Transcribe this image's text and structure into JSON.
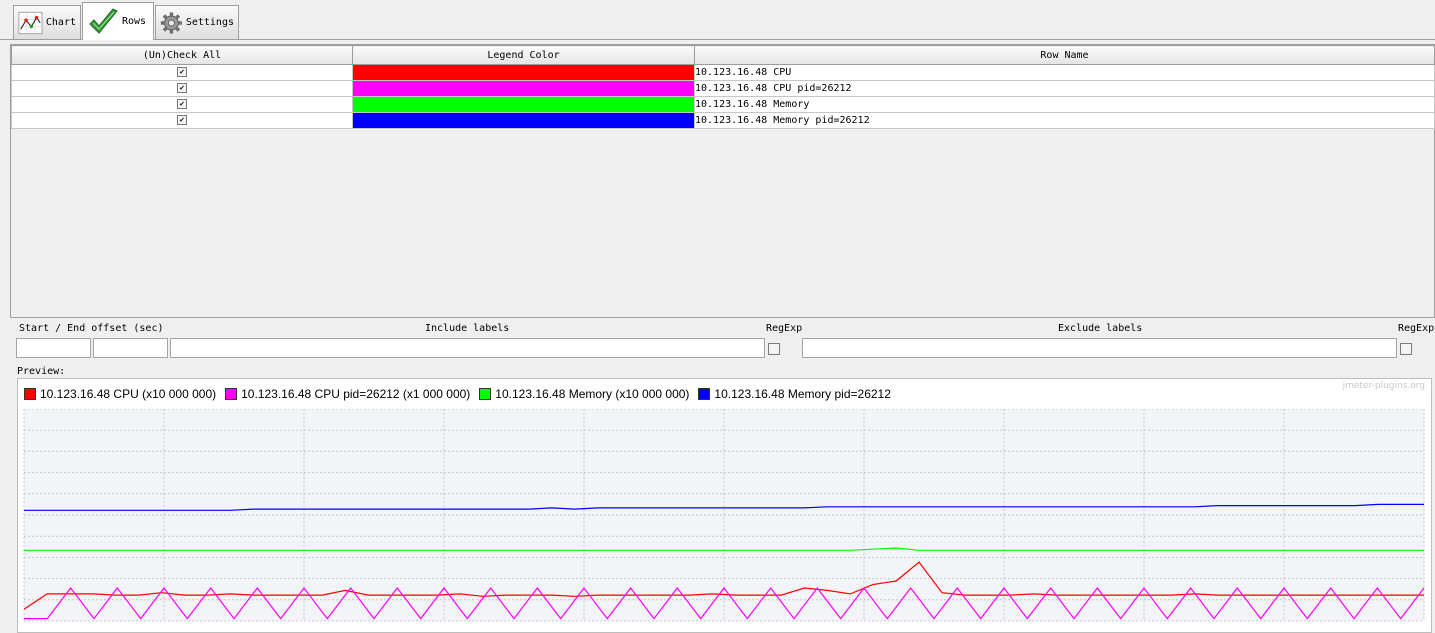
{
  "tabs": [
    {
      "label": "Chart",
      "icon": "line-chart-icon"
    },
    {
      "label": "Rows",
      "icon": "checkmark-icon"
    },
    {
      "label": "Settings",
      "icon": "gear-icon"
    }
  ],
  "rows_table": {
    "headers": [
      "(Un)Check All",
      "Legend Color",
      "Row Name"
    ],
    "rows": [
      {
        "checked": true,
        "color": "#ff0000",
        "name": "10.123.16.48 CPU"
      },
      {
        "checked": true,
        "color": "#ff00ff",
        "name": "10.123.16.48 CPU pid=26212"
      },
      {
        "checked": true,
        "color": "#00ff00",
        "name": "10.123.16.48 Memory"
      },
      {
        "checked": true,
        "color": "#0000ff",
        "name": "10.123.16.48 Memory pid=26212"
      }
    ]
  },
  "filters": {
    "offset_label": "Start / End offset (sec)",
    "include_label": "Include labels",
    "regexp_label": "RegExp",
    "exclude_label": "Exclude labels",
    "start_offset": "",
    "end_offset": "",
    "include_value": "",
    "exclude_value": "",
    "include_regexp_checked": false,
    "exclude_regexp_checked": false
  },
  "preview": {
    "label": "Preview:",
    "watermark": "jmeter-plugins.org"
  },
  "chart_data": {
    "type": "line",
    "grid": true,
    "legend_position": "top-left",
    "series": [
      {
        "name": "10.123.16.48 CPU (x10 000 000)",
        "color": "#ff0000",
        "values": [
          10,
          23,
          23,
          23,
          22,
          22,
          24,
          22,
          22,
          23,
          22,
          22,
          22,
          22,
          26,
          22,
          22,
          22,
          22,
          23,
          21,
          22,
          22,
          22,
          21,
          22,
          22,
          22,
          22,
          22,
          23,
          22,
          22,
          22,
          28,
          26,
          23,
          31,
          34,
          50,
          24,
          22,
          22,
          22,
          23,
          22,
          22,
          22,
          22,
          22,
          22,
          23,
          22,
          22,
          22,
          22,
          22,
          22,
          22,
          22,
          22,
          22
        ]
      },
      {
        "name": "10.123.16.48 CPU pid=26212 (x1 000 000)",
        "color": "#ff00ff",
        "values": [
          2,
          2,
          28,
          2,
          28,
          2,
          28,
          2,
          28,
          2,
          28,
          2,
          28,
          2,
          28,
          2,
          28,
          2,
          28,
          2,
          28,
          2,
          28,
          2,
          28,
          2,
          28,
          2,
          28,
          2,
          28,
          2,
          28,
          2,
          28,
          2,
          28,
          2,
          28,
          2,
          28,
          2,
          28,
          2,
          28,
          2,
          28,
          2,
          28,
          2,
          28,
          2,
          28,
          2,
          28,
          2,
          28,
          2,
          28,
          2,
          28
        ]
      },
      {
        "name": "10.123.16.48 Memory (x10 000 000)",
        "color": "#00ff00",
        "values": [
          60,
          60,
          60,
          60,
          60,
          60,
          60,
          60,
          60,
          60,
          60,
          60,
          60,
          60,
          60,
          60,
          60,
          60,
          60,
          60,
          60,
          60,
          60,
          60,
          60,
          60,
          60,
          60,
          60,
          60,
          60,
          60,
          60,
          60,
          60,
          60,
          60,
          61,
          62,
          60,
          60,
          60,
          60,
          60,
          60,
          60,
          60,
          60,
          60,
          60,
          60,
          60,
          60,
          60,
          60,
          60,
          60,
          60,
          60,
          60,
          60,
          60
        ]
      },
      {
        "name": "10.123.16.48 Memory pid=26212",
        "color": "#0000ff",
        "values": [
          94,
          94,
          94,
          94,
          94,
          94,
          94,
          94,
          94,
          94,
          95,
          95,
          95,
          95,
          95,
          95,
          95,
          95,
          95,
          95,
          95,
          95,
          95,
          96,
          95,
          96,
          96,
          96,
          96,
          96,
          96,
          96,
          96,
          96,
          96,
          97,
          97,
          97,
          97,
          97,
          97,
          97,
          97,
          97,
          97,
          97,
          97,
          97,
          97,
          97,
          97,
          97,
          98,
          98,
          98,
          98,
          98,
          98,
          98,
          99,
          99,
          99
        ]
      }
    ],
    "ylim": [
      0,
      180
    ]
  }
}
